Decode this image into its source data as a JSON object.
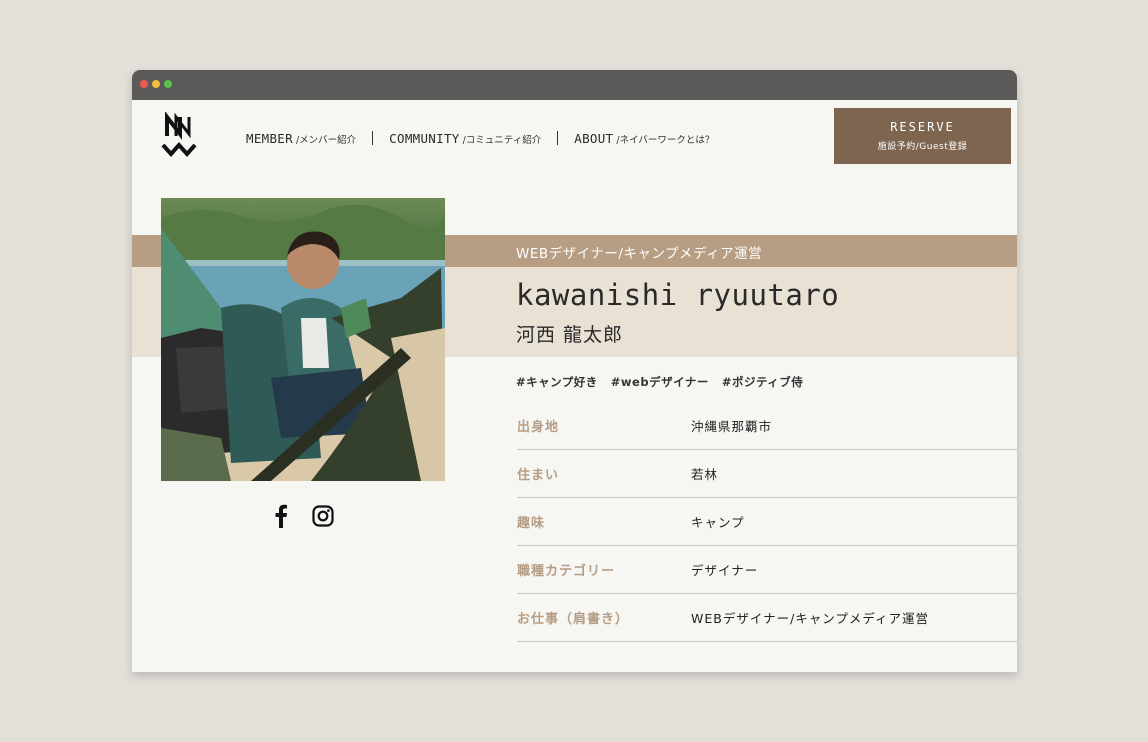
{
  "header": {
    "logo_alt": "NW",
    "nav": [
      {
        "label": "MEMBER",
        "sub": "/メンバー紹介"
      },
      {
        "label": "COMMUNITY",
        "sub": "/コミュニティ紹介"
      },
      {
        "label": "ABOUT",
        "sub": "/ネイバーワークとは？"
      }
    ],
    "reserve": {
      "label": "RESERVE",
      "sub": "施設予約/Guest登録",
      "color": "#7d6550"
    }
  },
  "profile": {
    "role": "WEBデザイナー/キャンプメディア運営",
    "name_en": "kawanishi ryuutaro",
    "name_jp": "河西 龍太郎",
    "tags": [
      "#キャンプ好き",
      "#webデザイナー",
      "#ポジティブ侍"
    ],
    "social": [
      "facebook-icon",
      "instagram-icon"
    ],
    "details": [
      {
        "label": "出身地",
        "value": "沖縄県那覇市"
      },
      {
        "label": "住まい",
        "value": "若林"
      },
      {
        "label": "趣味",
        "value": "キャンプ"
      },
      {
        "label": "職種カテゴリー",
        "value": "デザイナー"
      },
      {
        "label": "お仕事（肩書き）",
        "value": "WEBデザイナー/キャンプメディア運営"
      }
    ]
  },
  "colors": {
    "accent": "#b79d83",
    "band_light": "#e9e1d4",
    "background": "#f6f6f3"
  }
}
